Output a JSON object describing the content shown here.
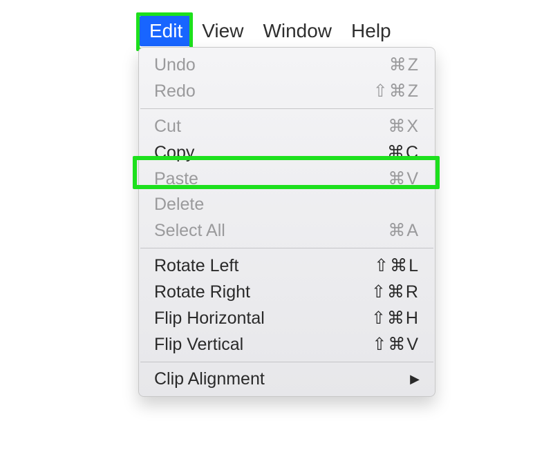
{
  "menubar": {
    "items": [
      {
        "label": "Edit",
        "active": true
      },
      {
        "label": "View",
        "active": false
      },
      {
        "label": "Window",
        "active": false
      },
      {
        "label": "Help",
        "active": false
      }
    ]
  },
  "menu": {
    "sections": [
      [
        {
          "label": "Undo",
          "shortcut": "⌘Z",
          "enabled": false
        },
        {
          "label": "Redo",
          "shortcut": "⇧⌘Z",
          "enabled": false
        }
      ],
      [
        {
          "label": "Cut",
          "shortcut": "⌘X",
          "enabled": false
        },
        {
          "label": "Copy",
          "shortcut": "⌘C",
          "enabled": true,
          "highlighted": true
        },
        {
          "label": "Paste",
          "shortcut": "⌘V",
          "enabled": false
        },
        {
          "label": "Delete",
          "shortcut": "",
          "enabled": false
        },
        {
          "label": "Select All",
          "shortcut": "⌘A",
          "enabled": false
        }
      ],
      [
        {
          "label": "Rotate Left",
          "shortcut": "⇧⌘L",
          "enabled": true
        },
        {
          "label": "Rotate Right",
          "shortcut": "⇧⌘R",
          "enabled": true
        },
        {
          "label": "Flip Horizontal",
          "shortcut": "⇧⌘H",
          "enabled": true
        },
        {
          "label": "Flip Vertical",
          "shortcut": "⇧⌘V",
          "enabled": true
        }
      ],
      [
        {
          "label": "Clip Alignment",
          "shortcut": "",
          "enabled": true,
          "submenu": true
        }
      ]
    ]
  },
  "highlight_color": "#1de01d",
  "accent_color": "#1865ff"
}
